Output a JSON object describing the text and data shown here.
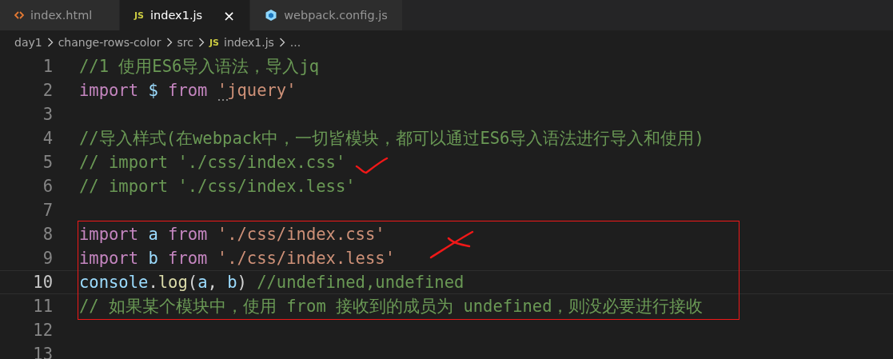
{
  "tabs": [
    {
      "label": "index.html",
      "kind": "html",
      "selected": false
    },
    {
      "label": "index1.js",
      "kind": "js",
      "selected": true,
      "close": "×"
    },
    {
      "label": "webpack.config.js",
      "kind": "webpack",
      "selected": false
    }
  ],
  "breadcrumb": [
    {
      "label": "day1"
    },
    {
      "label": "change-rows-color"
    },
    {
      "label": "src"
    },
    {
      "label": "index1.js",
      "kind": "js",
      "icon_text": "JS"
    },
    {
      "label": "..."
    }
  ],
  "tab_icon_text": "JS",
  "lines": [
    {
      "number": "1",
      "current": false,
      "tokens": [
        {
          "kind": "comment",
          "text": "//1 使用ES6导入语法，导入jq"
        }
      ]
    },
    {
      "number": "2",
      "current": false,
      "hint": true,
      "tokens": [
        {
          "kind": "keyword",
          "text": "import "
        },
        {
          "kind": "var",
          "text": "$ "
        },
        {
          "kind": "keyword",
          "text": "from "
        },
        {
          "kind": "string",
          "text": "'jquery'"
        }
      ]
    },
    {
      "number": "3",
      "current": false
    },
    {
      "number": "4",
      "current": false,
      "tokens": [
        {
          "kind": "comment",
          "text": "//导入样式(在webpack中，一切皆模块，都可以通过ES6导入语法进行导入和使用)"
        }
      ]
    },
    {
      "number": "5",
      "current": false,
      "tokens": [
        {
          "kind": "comment",
          "text": "// import './css/index.css'"
        }
      ]
    },
    {
      "number": "6",
      "current": false,
      "tokens": [
        {
          "kind": "comment",
          "text": "// import './css/index.less'"
        }
      ]
    },
    {
      "number": "7",
      "current": false
    },
    {
      "number": "8",
      "current": false,
      "tokens": [
        {
          "kind": "keyword",
          "text": "import "
        },
        {
          "kind": "var",
          "text": "a "
        },
        {
          "kind": "keyword",
          "text": "from "
        },
        {
          "kind": "string",
          "text": "'./css/index.css'"
        }
      ]
    },
    {
      "number": "9",
      "current": false,
      "tokens": [
        {
          "kind": "keyword",
          "text": "import "
        },
        {
          "kind": "var",
          "text": "b "
        },
        {
          "kind": "keyword",
          "text": "from "
        },
        {
          "kind": "string",
          "text": "'./css/index.less'"
        }
      ]
    },
    {
      "number": "10",
      "current": true,
      "tokens": [
        {
          "kind": "var",
          "text": "console"
        },
        {
          "kind": "punct",
          "text": "."
        },
        {
          "kind": "func",
          "text": "log"
        },
        {
          "kind": "punct",
          "text": "("
        },
        {
          "kind": "var",
          "text": "a"
        },
        {
          "kind": "punct",
          "text": ", "
        },
        {
          "kind": "var",
          "text": "b"
        },
        {
          "kind": "punct",
          "text": ") "
        },
        {
          "kind": "comment",
          "text": "//undefined,undefined"
        }
      ]
    },
    {
      "number": "11",
      "current": false,
      "tokens": [
        {
          "kind": "comment",
          "text": "// 如果某个模块中，使用 from 接收到的成员为 undefined，则没必要进行接收"
        }
      ]
    },
    {
      "number": "12",
      "current": false
    },
    {
      "number": "13",
      "current": false
    }
  ],
  "annotations": [
    {
      "kind": "check"
    },
    {
      "kind": "cross"
    },
    {
      "kind": "box"
    }
  ]
}
